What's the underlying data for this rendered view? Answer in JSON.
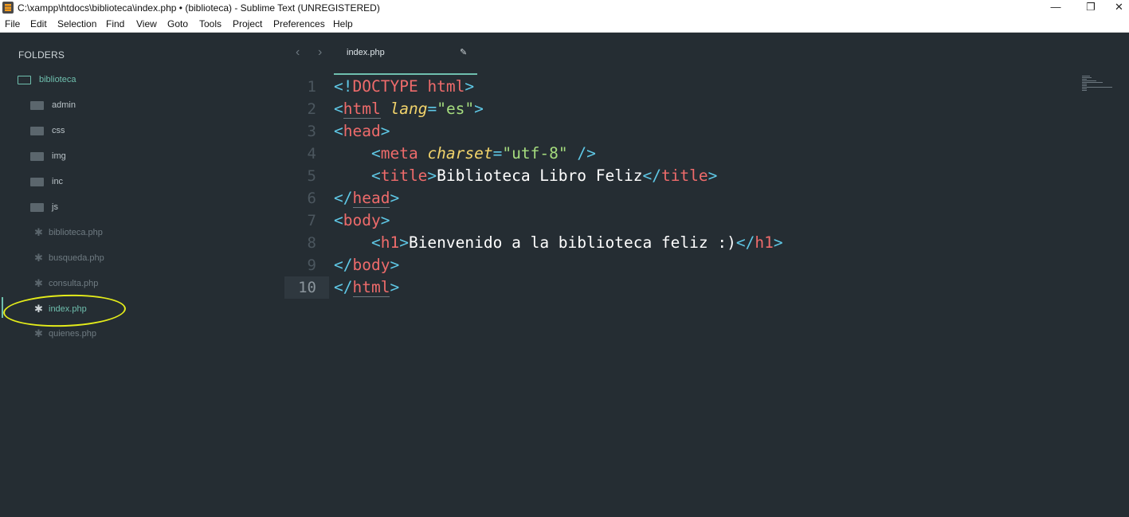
{
  "window": {
    "title": "C:\\xampp\\htdocs\\biblioteca\\index.php • (biblioteca) - Sublime Text (UNREGISTERED)",
    "minimize_glyph": "—",
    "maximize_glyph": "❐",
    "close_glyph": "✕"
  },
  "menu": [
    "File",
    "Edit",
    "Selection",
    "Find",
    "View",
    "Goto",
    "Tools",
    "Project",
    "Preferences",
    "Help"
  ],
  "sidebar": {
    "header": "FOLDERS",
    "root": "biblioteca",
    "folders": [
      "admin",
      "css",
      "img",
      "inc",
      "js"
    ],
    "files": [
      "biblioteca.php",
      "busqueda.php",
      "consulta.php",
      "index.php",
      "quienes.php"
    ],
    "selected_file": "index.php"
  },
  "tab": {
    "label": "index.php",
    "edit_glyph": "✎"
  },
  "nav": {
    "back": "‹",
    "forward": "›"
  },
  "editor": {
    "line_numbers": [
      "1",
      "2",
      "3",
      "4",
      "5",
      "6",
      "7",
      "8",
      "9",
      "10"
    ],
    "current_line": "10",
    "lines": [
      "<!DOCTYPE html>",
      "<html lang=\"es\">",
      "<head>",
      "    <meta charset=\"utf-8\" />",
      "    <title>Biblioteca Libro Feliz</title>",
      "</head>",
      "<body>",
      "    <h1>Bienvenido a la biblioteca feliz :)</h1>",
      "</body>",
      "</html>"
    ]
  },
  "colors": {
    "background": "#252d33",
    "punctuation": "#5fc8e6",
    "tag": "#ee6b6b",
    "attribute": "#f1d36b",
    "string": "#a5dc7e",
    "accent": "#6fbfae",
    "annotation": "#e4ec1a"
  }
}
